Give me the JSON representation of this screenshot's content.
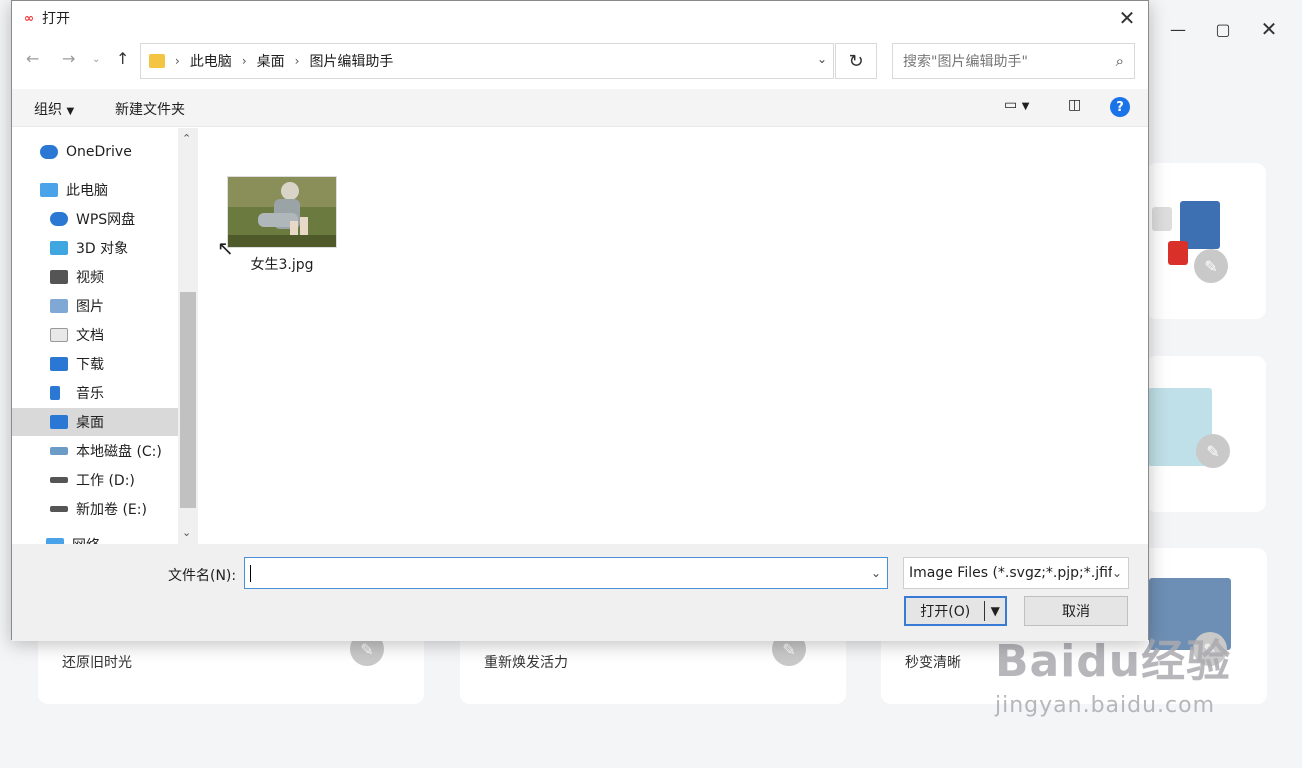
{
  "dialog": {
    "title": "打开",
    "breadcrumb": [
      "此电脑",
      "桌面",
      "图片编辑助手"
    ],
    "search_placeholder": "搜索\"图片编辑助手\"",
    "toolbar": {
      "organize": "组织",
      "new_folder": "新建文件夹"
    },
    "nav_items": [
      {
        "label": "OneDrive",
        "icon": "cloud-icon"
      },
      {
        "label": "此电脑",
        "icon": "computer-icon"
      },
      {
        "label": "WPS网盘",
        "icon": "cloud-icon"
      },
      {
        "label": "3D 对象",
        "icon": "cube-icon"
      },
      {
        "label": "视频",
        "icon": "video-icon"
      },
      {
        "label": "图片",
        "icon": "picture-icon"
      },
      {
        "label": "文档",
        "icon": "document-icon"
      },
      {
        "label": "下载",
        "icon": "download-icon"
      },
      {
        "label": "音乐",
        "icon": "music-icon"
      },
      {
        "label": "桌面",
        "icon": "desktop-icon",
        "selected": true
      },
      {
        "label": "本地磁盘 (C:)",
        "icon": "drive-icon"
      },
      {
        "label": "工作 (D:)",
        "icon": "drive-icon"
      },
      {
        "label": "新加卷 (E:)",
        "icon": "drive-icon"
      },
      {
        "label": "网络",
        "icon": "network-icon"
      }
    ],
    "files": [
      {
        "name": "女生3.jpg"
      }
    ],
    "filename_label": "文件名(N):",
    "filename_value": "",
    "file_type": "Image Files (*.svgz;*.pjp;*.jfif;",
    "open_button": "打开(O)",
    "cancel_button": "取消"
  },
  "background": {
    "cards": [
      {
        "label": "还原旧时光"
      },
      {
        "label": "重新焕发活力"
      },
      {
        "label": "秒变清晰"
      }
    ]
  },
  "watermark": {
    "main": "Baidu经验",
    "sub": "jingyan.baidu.com"
  }
}
